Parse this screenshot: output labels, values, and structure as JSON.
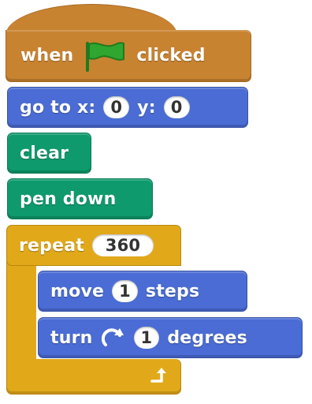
{
  "script": {
    "hat": {
      "when": "when",
      "flag_icon": "green-flag",
      "clicked": "clicked"
    },
    "goto": {
      "label_go": "go to x:",
      "x": "0",
      "label_y": "y:",
      "y": "0"
    },
    "clear": {
      "label": "clear"
    },
    "pen_down": {
      "label": "pen down"
    },
    "repeat": {
      "label": "repeat",
      "count": "360"
    },
    "move": {
      "label": "move",
      "steps": "1",
      "suffix": "steps"
    },
    "turn": {
      "label": "turn",
      "icon": "rotate-clockwise",
      "degrees": "1",
      "suffix": "degrees"
    }
  },
  "colors": {
    "events": "#c88330",
    "motion": "#4a6cd4",
    "pen": "#0e9a6c",
    "control": "#e1a91a",
    "flag": "#2fa62f"
  }
}
